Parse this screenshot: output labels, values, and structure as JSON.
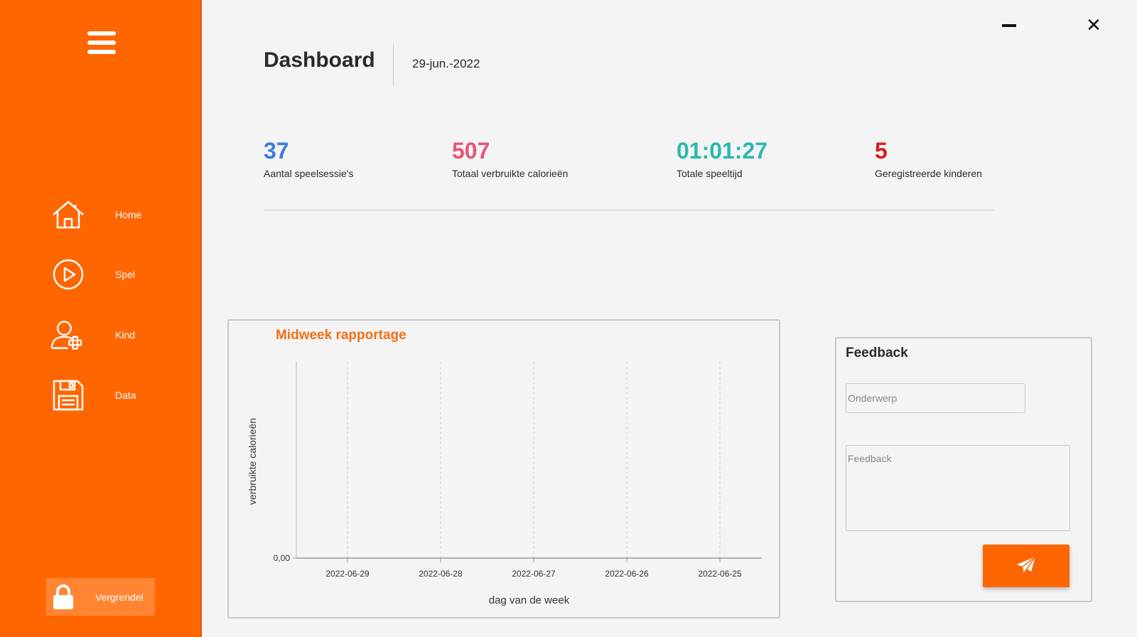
{
  "colors": {
    "sidebar": "#ff6600",
    "accent": "#ff6600",
    "chart_title": "#f07013",
    "stat_sessions": "#3b7ddd",
    "stat_calories": "#e8557a",
    "stat_playtime": "#2bb8b0",
    "stat_children": "#d42020"
  },
  "sidebar": {
    "items": [
      {
        "label": "Home",
        "icon": "home-icon"
      },
      {
        "label": "Spel",
        "icon": "play-icon"
      },
      {
        "label": "Kind",
        "icon": "add-user-icon"
      },
      {
        "label": "Data",
        "icon": "floppy-disk-icon"
      }
    ],
    "lock_label": "Vergrendel"
  },
  "header": {
    "title": "Dashboard",
    "date": "29-jun.-2022"
  },
  "stats": [
    {
      "value": "37",
      "caption": "Aantal speelsessie's"
    },
    {
      "value": "507",
      "caption": "Totaal verbruikte calorieën"
    },
    {
      "value": "01:01:27",
      "caption": "Totale speeltijd"
    },
    {
      "value": "5",
      "caption": "Geregistreerde kinderen"
    }
  ],
  "chart_data": {
    "type": "line",
    "title": "Midweek rapportage",
    "xlabel": "dag van de week",
    "ylabel": "verbruikte calorieën",
    "categories": [
      "2022-06-29",
      "2022-06-28",
      "2022-06-27",
      "2022-06-26",
      "2022-06-25"
    ],
    "y_ticks": [
      "0,00"
    ],
    "series": [],
    "grid": true
  },
  "feedback": {
    "title": "Feedback",
    "subject_placeholder": "Onderwerp",
    "body_placeholder": "Feedback",
    "send_icon": "paper-plane-icon"
  }
}
